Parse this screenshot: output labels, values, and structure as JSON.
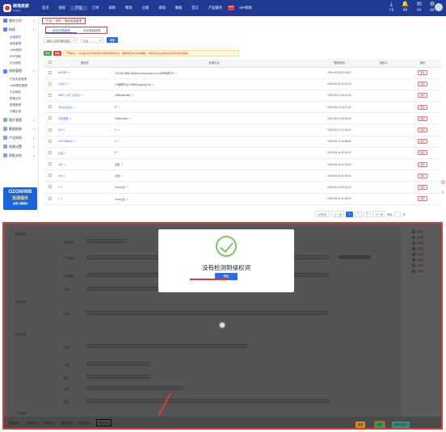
{
  "app": {
    "logo_title": "跨境卖家",
    "logo_subtitle": "kuajing",
    "nav": [
      "首页",
      "授权",
      "产品",
      "订单",
      "采购",
      "物流",
      "仓储",
      "采购",
      "数据",
      "官方",
      "产品服务",
      "VIP权限"
    ],
    "nav_badge": "NEW",
    "top_icons": [
      {
        "icon": "download-icon",
        "label": "下载"
      },
      {
        "icon": "bell-icon",
        "label": "通知"
      },
      {
        "icon": "message-icon",
        "label": "消息"
      },
      {
        "icon": "settings-icon",
        "label": "设置"
      }
    ]
  },
  "sidebar": {
    "groups": [
      {
        "label": "我的工作",
        "icon": "home-icon"
      },
      {
        "label": "授权",
        "icon": "key-icon"
      }
    ],
    "subs1": [
      "店铺授权",
      "授权管理",
      "1688授权",
      "ERP授权",
      "平台授权"
    ],
    "group2": {
      "label": "授权管理",
      "icon": "list-icon"
    },
    "subs2": [
      "产品信息管理",
      "1688授权管理",
      "平台授权",
      "数据分析",
      "数据管理",
      "问题反馈"
    ],
    "groups_after": [
      {
        "label": "图片管理",
        "icon": "image-icon"
      },
      {
        "label": "数据报表",
        "icon": "chart-icon"
      },
      {
        "label": "产品授权",
        "icon": "box-icon"
      },
      {
        "label": "权限设置",
        "icon": "lock-icon"
      },
      {
        "label": "帮助文档",
        "icon": "help-icon"
      }
    ],
    "banner": {
      "line1": "OZON/WB",
      "line2": "货源插件",
      "line3": "免费下载使用"
    }
  },
  "breadcrumb": "产品 > 采购 > 授权链接管理",
  "tabs": [
    "授权资源管理",
    "平台授权权限"
  ],
  "filters": {
    "first": "请输入名称/授权链接",
    "second": "平台",
    "search_label": "搜索"
  },
  "toolbar": {
    "add": "添加",
    "delete": "删除",
    "notice": "严重提示：请在提交任何授权前仔细阅读授权协议，确保授权信息的准确性，授权成功后系统将自动同步相关数据。"
  },
  "table": {
    "headers": [
      "",
      "授权名",
      "来源平台",
      "更新时间",
      "授权人",
      "操作"
    ],
    "rows": [
      {
        "name": "ASGRC",
        "platform": "OZON(1688)-Alibaba-AliexpressCom-1688商城PDF",
        "time": "2020-06-26 22:26:01",
        "op": "删除"
      },
      {
        "name": "1(3)(1)",
        "platform": "OZ编辑平台-1688ShoppingCart",
        "time": "2020-06-30 15:13:23",
        "op": "删除"
      },
      {
        "name": "ASIN_LIST_2(1)(1)",
        "platform": "2688(alibaba)",
        "time": "2020-06-22 16:37:41",
        "op": "删除"
      },
      {
        "name": "3(1)(1)(1)(1)",
        "platform": "R",
        "time": "2020-06-20 10:11:31",
        "op": "删除"
      },
      {
        "name": "平台授权",
        "platform": "Wildberries",
        "time": "2020-06-03 18:06:20",
        "op": "删除"
      },
      {
        "name": "111",
        "platform": "Z",
        "time": "2020-06-17 11:46:01",
        "op": "删除"
      },
      {
        "name": "20170904(1)",
        "platform": "Z",
        "time": "2020-06-11 16:58:40",
        "op": "删除"
      },
      {
        "name": "认证",
        "platform": "R",
        "time": "2020-06-11 15:33:12",
        "op": "删除"
      },
      {
        "name": "222",
        "platform": "全部",
        "time": "2020-06-10 11:29:03",
        "op": "删除"
      },
      {
        "name": "111",
        "platform": "全部",
        "time": "2020-06-08 11:28:04",
        "op": "删除"
      },
      {
        "name": "1",
        "platform": "Ozon(全)",
        "time": "2020-06-04 09:22:20",
        "op": "删除"
      },
      {
        "name": "1",
        "platform": "Ozon(全)",
        "time": "2020-06-01 11:46:20",
        "op": "删除"
      }
    ]
  },
  "pager": {
    "prev": "上一页",
    "next": "下一页",
    "current": "1",
    "pages": [
      "2",
      "3"
    ],
    "goto": "跳至",
    "unit": "页",
    "total": "10条/页"
  },
  "modal": {
    "message": "没有检测到侵权词",
    "ok": "确定"
  },
  "form": {
    "labels": [
      "基础信息",
      "商品类目",
      "产品名称",
      "商品编号",
      "型号",
      "品牌信息",
      "标签",
      "基础价格",
      "规格",
      "价格",
      "库存",
      "分类",
      "属性",
      "产品描述"
    ],
    "right_list": [
      "未填写",
      "未填写",
      "未填写",
      "已填写",
      "未填写",
      "未填写",
      "未填写",
      "未填写"
    ]
  },
  "bottom_bar": {
    "items": [
      "基础信息",
      "价格信息",
      "规格信息",
      "图片信息",
      "描述信息",
      "侵权检测"
    ],
    "buttons": [
      "取消",
      "保存",
      "保存并发布"
    ]
  },
  "colors": {
    "brand": "#1f3a93",
    "accent": "#2b6ce5",
    "danger": "#e53935",
    "success": "#43a047"
  }
}
